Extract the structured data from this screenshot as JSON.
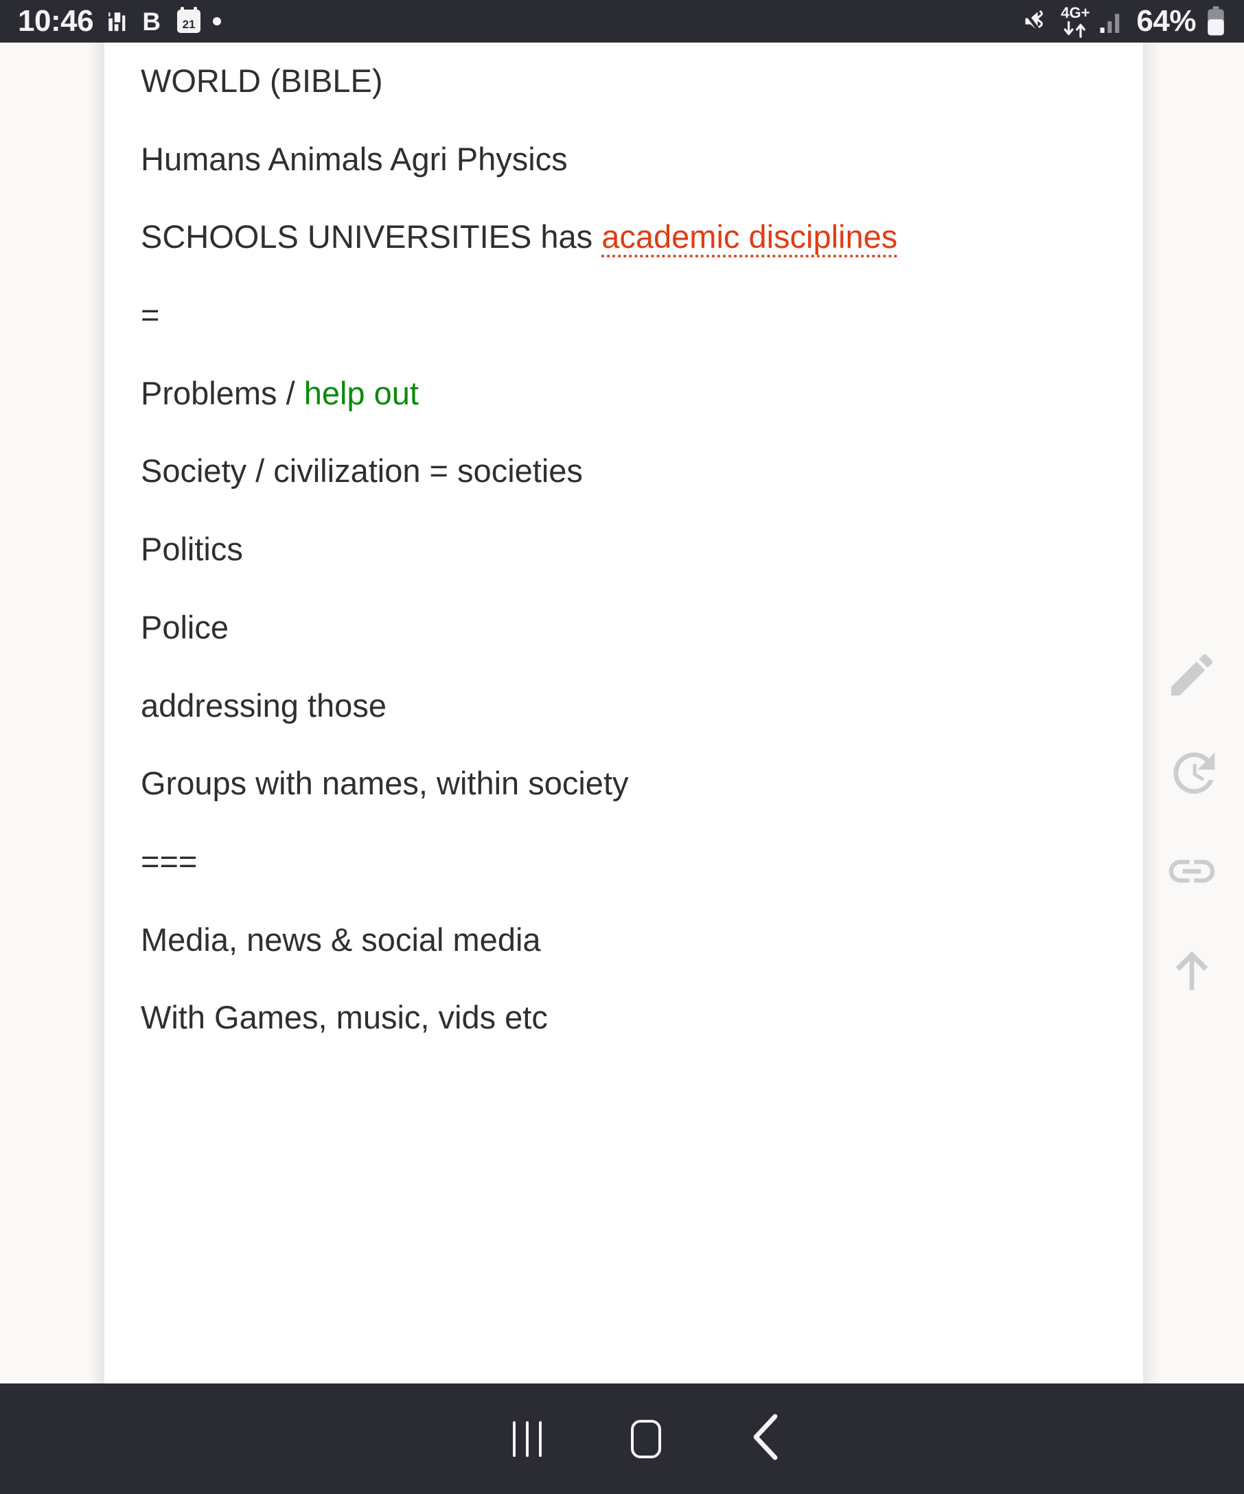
{
  "status_bar": {
    "time": "10:46",
    "battery_percent": "64%",
    "network_type": "4G+",
    "calendar_day": "21",
    "icons": [
      "equalizer-icon",
      "bold-b-icon",
      "calendar-icon",
      "dot-icon",
      "mute-vibrate-icon",
      "data-transfer-icon",
      "signal-bars-icon",
      "battery-icon"
    ],
    "background_color": "#2b2b33",
    "text_color": "#f4f4f6"
  },
  "note": {
    "background_color": "#ffffff",
    "page_color": "#faf9f7",
    "text_color": "#2f2f2f",
    "spell_error_color": "#e03c14",
    "highlight_green_color": "#0b8a0b",
    "lines": [
      {
        "id": "line-world",
        "text": "WORLD (BIBLE)"
      },
      {
        "id": "line-humans",
        "text": "Humans Animals Agri Physics"
      },
      {
        "id": "line-schools",
        "prefix": "SCHOOLS UNIVERSITIES has ",
        "spell_error": "academic disciplines"
      },
      {
        "id": "line-eq-1",
        "text": "="
      },
      {
        "id": "line-problems",
        "prefix": "Problems / ",
        "green": "help out"
      },
      {
        "id": "line-society",
        "text": "Society / civilization = societies"
      },
      {
        "id": "line-politics",
        "text": "Politics"
      },
      {
        "id": "line-police",
        "text": "Police"
      },
      {
        "id": "line-addressing",
        "text": "addressing those"
      },
      {
        "id": "line-groups",
        "text": "Groups with names, within society"
      },
      {
        "id": "line-eq-3",
        "text": "==="
      },
      {
        "id": "line-media",
        "text": "Media, news & social media"
      },
      {
        "id": "line-games",
        "text": "With Games, music, vids etc"
      }
    ]
  },
  "tool_rail": {
    "icon_color": "#cdcdcd",
    "items": [
      {
        "name": "edit-pencil-icon",
        "label": "Edit"
      },
      {
        "name": "history-icon",
        "label": "Version history"
      },
      {
        "name": "link-icon",
        "label": "Link"
      },
      {
        "name": "scroll-top-arrow-icon",
        "label": "Scroll to top"
      }
    ]
  },
  "nav_bar": {
    "background_color": "#2b2b33",
    "icon_color": "#f4f4f6",
    "buttons": [
      {
        "name": "nav-recents-button",
        "label": "Recents"
      },
      {
        "name": "nav-home-button",
        "label": "Home"
      },
      {
        "name": "nav-back-button",
        "label": "Back"
      }
    ]
  }
}
